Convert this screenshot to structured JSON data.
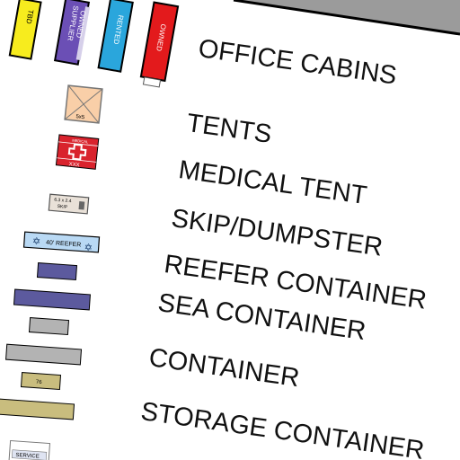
{
  "legend": {
    "office_cabins": {
      "label": "OFFICE CABINS",
      "variants": [
        {
          "tag": "TBD",
          "color": "#f7ec1e"
        },
        {
          "tag": "SUPPLIER OWNED",
          "color": "#6b4fb5"
        },
        {
          "tag": "RENTED",
          "color": "#2aa6dc"
        },
        {
          "tag": "OWNED",
          "color": "#e31a1c"
        }
      ]
    },
    "tents": {
      "label": "TENTS",
      "symbol_text": "5x5",
      "color": "#f9cfa8"
    },
    "medical_tent": {
      "label": "MEDICAL TENT",
      "symbol_top": "MEDICAL",
      "symbol_bottom": "XXX",
      "color": "#d9232d"
    },
    "skip": {
      "label": "SKIP/DUMPSTER",
      "symbol_line1": "6.3 x 2.4",
      "symbol_line2": "SKIP",
      "color": "#e9e1d8"
    },
    "reefer": {
      "label": "REEFER CONTAINER",
      "symbol_text": "40' REEFER",
      "color": "#b9d9f4"
    },
    "sea": {
      "label": "SEA CONTAINER",
      "color": "#5c5a9e"
    },
    "container": {
      "label": "CONTAINER",
      "color": "#b3b3b3"
    },
    "storage": {
      "label": "STORAGE CONTAINER",
      "symbol_text": "76",
      "color": "#c9bd7e"
    },
    "service": {
      "symbol_text": "SERVICE"
    }
  }
}
